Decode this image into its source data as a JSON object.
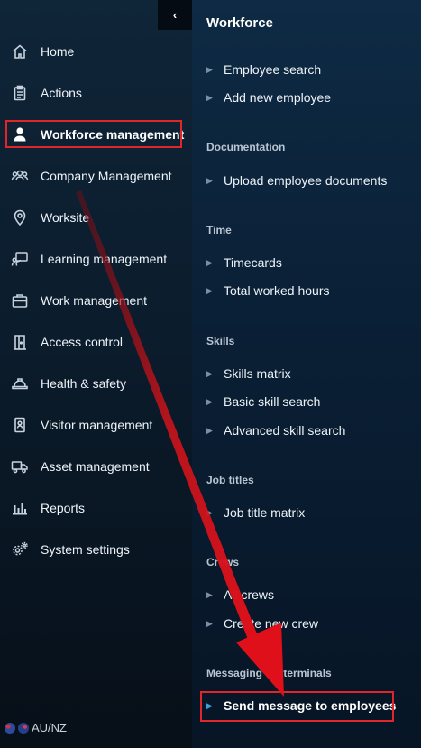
{
  "sidebar": {
    "collapse_glyph": "‹",
    "items": [
      {
        "label": "Home",
        "icon": "home-icon"
      },
      {
        "label": "Actions",
        "icon": "clipboard-icon"
      },
      {
        "label": "Workforce management",
        "icon": "person-icon",
        "active": true
      },
      {
        "label": "Company Management",
        "icon": "group-icon"
      },
      {
        "label": "Worksite",
        "icon": "map-pin-icon"
      },
      {
        "label": "Learning management",
        "icon": "presenter-icon"
      },
      {
        "label": "Work management",
        "icon": "briefcase-icon"
      },
      {
        "label": "Access control",
        "icon": "door-icon"
      },
      {
        "label": "Health & safety",
        "icon": "hardhat-icon"
      },
      {
        "label": "Visitor management",
        "icon": "badge-icon"
      },
      {
        "label": "Asset management",
        "icon": "truck-icon"
      },
      {
        "label": "Reports",
        "icon": "bar-chart-icon"
      },
      {
        "label": "System settings",
        "icon": "gears-icon"
      }
    ],
    "locale": "AU/NZ"
  },
  "panel": {
    "title": "Workforce",
    "sections": [
      {
        "heading": "",
        "links": [
          "Employee search",
          "Add new employee"
        ]
      },
      {
        "heading": "Documentation",
        "links": [
          "Upload employee documents"
        ]
      },
      {
        "heading": "Time",
        "links": [
          "Timecards",
          "Total worked hours"
        ]
      },
      {
        "heading": "Skills",
        "links": [
          "Skills matrix",
          "Basic skill search",
          "Advanced skill search"
        ]
      },
      {
        "heading": "Job titles",
        "links": [
          "Job title matrix"
        ]
      },
      {
        "heading": "Crews",
        "links": [
          "All crews",
          "Create new crew"
        ]
      },
      {
        "heading": "Messaging via terminals",
        "links": [
          "Send message to employees"
        ]
      }
    ]
  },
  "colors": {
    "highlight_box": "#e0262b",
    "arrow": "#d0141c",
    "accent_caret": "#3aa0e0"
  }
}
